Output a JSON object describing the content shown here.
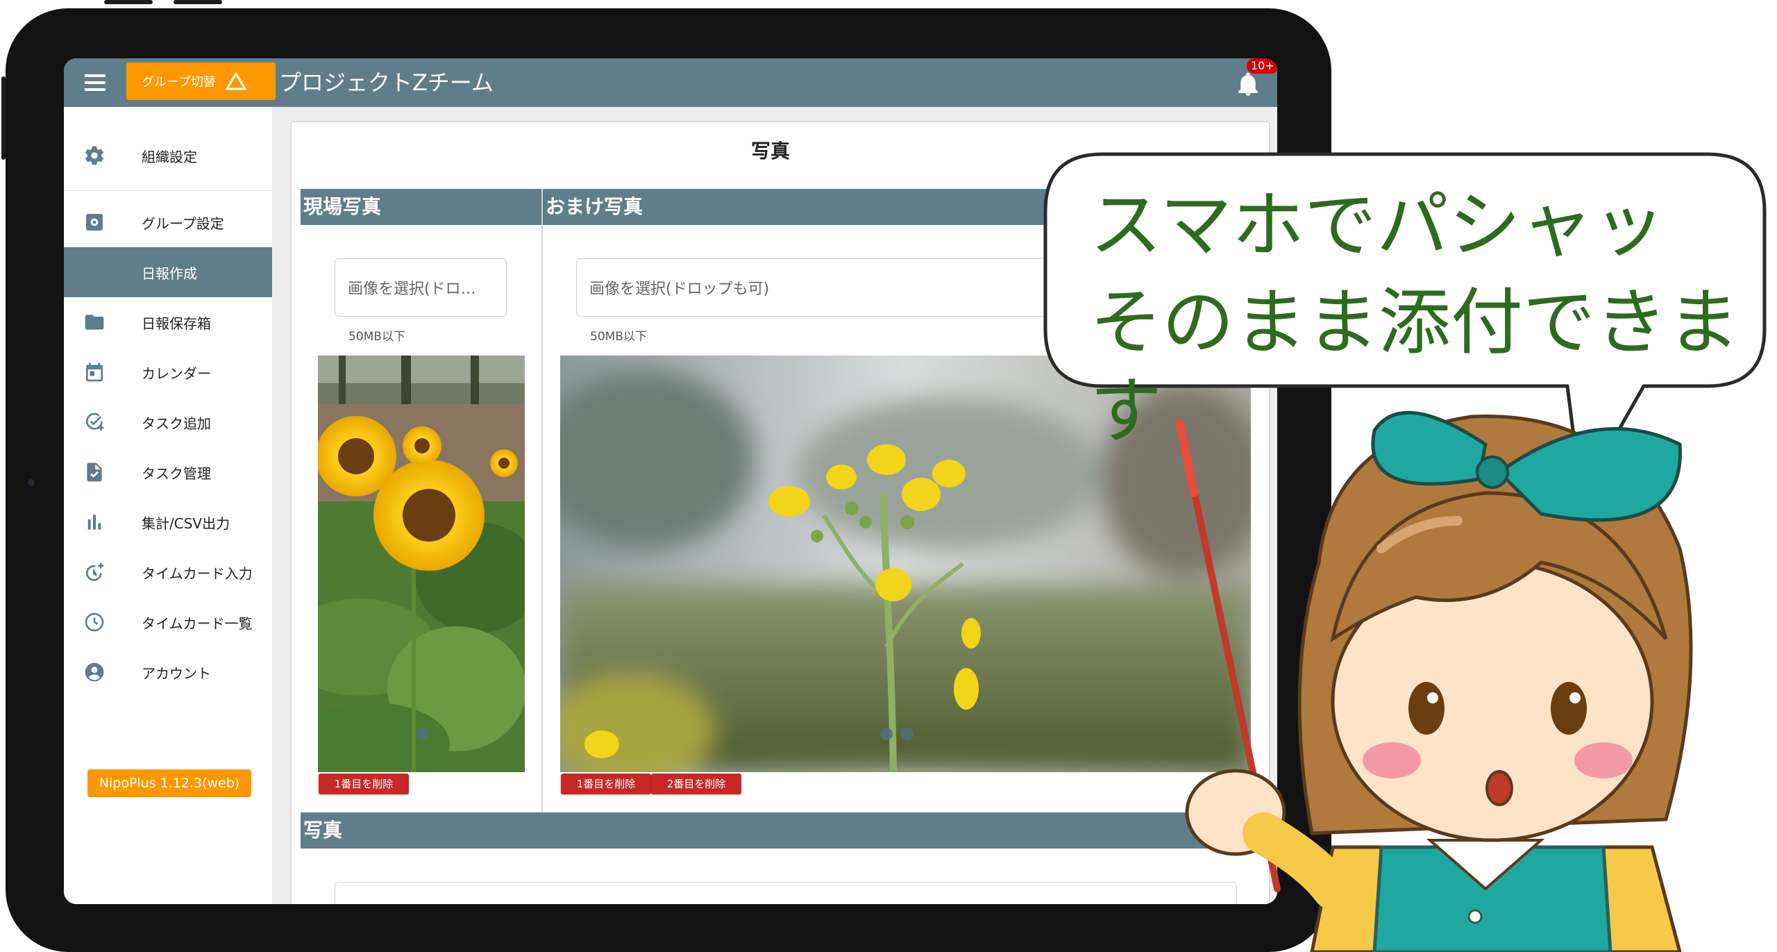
{
  "header": {
    "group_switch_label": "グループ切替",
    "team_name": "プロジェクトZチーム",
    "notification_badge": "10+"
  },
  "sidebar": {
    "items": [
      {
        "label": "組織設定",
        "icon": "gear-icon"
      },
      {
        "label": "グループ設定",
        "icon": "group-settings-icon"
      },
      {
        "label": "日報作成",
        "icon": "",
        "active": true
      },
      {
        "label": "日報保存箱",
        "icon": "folder-icon"
      },
      {
        "label": "カレンダー",
        "icon": "calendar-icon"
      },
      {
        "label": "タスク追加",
        "icon": "task-add-icon"
      },
      {
        "label": "タスク管理",
        "icon": "task-manage-icon"
      },
      {
        "label": "集計/CSV出力",
        "icon": "bar-chart-icon"
      },
      {
        "label": "タイムカード入力",
        "icon": "timecard-add-icon"
      },
      {
        "label": "タイムカード一覧",
        "icon": "clock-icon"
      },
      {
        "label": "アカウント",
        "icon": "account-icon"
      }
    ],
    "version": "NipoPlus 1.12.3(web)"
  },
  "main": {
    "title": "写真",
    "sections": [
      {
        "header": "現場写真",
        "upload_placeholder": "画像を選択(ドロ…",
        "hint": "50MB以下",
        "delete_buttons": [
          "1番目を削除"
        ]
      },
      {
        "header": "おまけ写真",
        "upload_placeholder": "画像を選択(ドロップも可)",
        "hint": "50MB以下",
        "delete_buttons": [
          "1番目を削除",
          "2番目を削除"
        ]
      },
      {
        "header": "写真"
      }
    ]
  },
  "callout": {
    "line1": "スマホでパシャッ",
    "line2": "そのまま添付できます"
  },
  "colors": {
    "primary": "#607d8b",
    "accent": "#ff9800",
    "danger": "#c62828",
    "callout_text": "#2d6b1f"
  }
}
